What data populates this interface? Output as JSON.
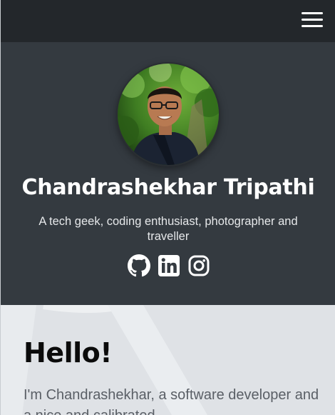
{
  "navbar": {
    "menu_icon": "hamburger-menu-icon"
  },
  "hero": {
    "name": "Chandrashekhar Tripathi",
    "tagline": "A tech geek, coding enthusiast, photographer and traveller",
    "socials": [
      {
        "icon": "github-icon"
      },
      {
        "icon": "linkedin-icon"
      },
      {
        "icon": "instagram-icon"
      }
    ]
  },
  "about": {
    "heading": "Hello!",
    "intro": "I'm Chandrashekhar, a software developer and a nice and calibrated"
  },
  "colors": {
    "navbar_bg": "#23272b",
    "hero_bg": "#343a40",
    "about_bg": "#dfe2e6",
    "icon_color": "#ffffff"
  }
}
